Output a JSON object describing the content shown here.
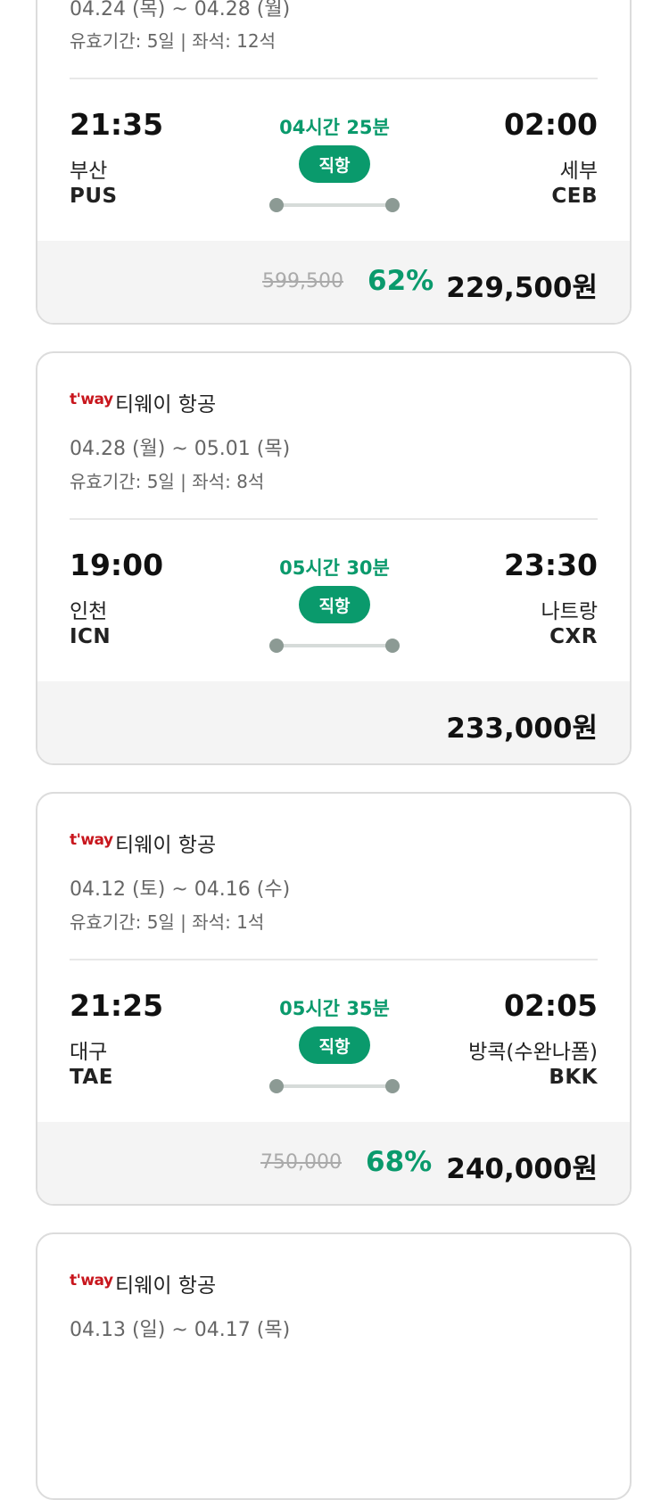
{
  "cards": [
    {
      "dates": "04.24 (목) ~ 04.28 (월)",
      "validity": "유효기간: 5일 | 좌석: 12석",
      "depart": {
        "time": "21:35",
        "city": "부산",
        "code": "PUS"
      },
      "arrive": {
        "time": "02:00",
        "city": "세부",
        "code": "CEB"
      },
      "duration": "04시간 25분",
      "direct_label": "직항",
      "original_price": "599,500",
      "discount": "62%",
      "price": "229,500원"
    },
    {
      "airline_logo": "t'way",
      "airline_name": "티웨이 항공",
      "dates": "04.28 (월) ~ 05.01 (목)",
      "validity": "유효기간: 5일 | 좌석: 8석",
      "depart": {
        "time": "19:00",
        "city": "인천",
        "code": "ICN"
      },
      "arrive": {
        "time": "23:30",
        "city": "나트랑",
        "code": "CXR"
      },
      "duration": "05시간 30분",
      "direct_label": "직항",
      "price": "233,000원"
    },
    {
      "airline_logo": "t'way",
      "airline_name": "티웨이 항공",
      "dates": "04.12 (토) ~ 04.16 (수)",
      "validity": "유효기간: 5일 | 좌석: 1석",
      "depart": {
        "time": "21:25",
        "city": "대구",
        "code": "TAE"
      },
      "arrive": {
        "time": "02:05",
        "city": "방콕(수완나폼)",
        "code": "BKK"
      },
      "duration": "05시간 35분",
      "direct_label": "직항",
      "original_price": "750,000",
      "discount": "68%",
      "price": "240,000원"
    },
    {
      "airline_logo": "t'way",
      "airline_name": "티웨이 항공",
      "dates": "04.13 (일) ~ 04.17 (목)"
    }
  ],
  "colors": {
    "accent": "#0a9a6c",
    "brand": "#c8161d",
    "border": "#dcdcdc"
  }
}
